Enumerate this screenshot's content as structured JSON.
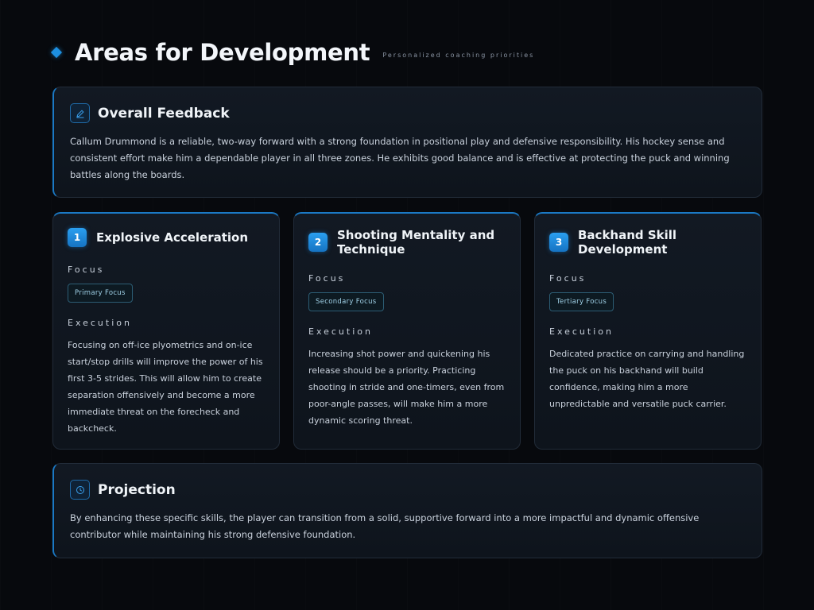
{
  "header": {
    "title": "Areas for Development",
    "subtitle": "Personalized coaching priorities"
  },
  "feedback": {
    "icon": "pencil-icon",
    "title": "Overall Feedback",
    "text": "Callum Drummond is a reliable, two-way forward with a strong foundation in positional play and defensive responsibility. His hockey sense and consistent effort make him a dependable player in all three zones. He exhibits good balance and is effective at protecting the puck and winning battles along the boards."
  },
  "areas": [
    {
      "number": "1",
      "title": "Explosive Acceleration",
      "focus_label": "Focus",
      "focus": "Primary Focus",
      "execution_label": "Execution",
      "execution": "Focusing on off-ice plyometrics and on-ice start/stop drills will improve the power of his first 3-5 strides. This will allow him to create separation offensively and become a more immediate threat on the forecheck and backcheck."
    },
    {
      "number": "2",
      "title": "Shooting Mentality and Technique",
      "focus_label": "Focus",
      "focus": "Secondary Focus",
      "execution_label": "Execution",
      "execution": "Increasing shot power and quickening his release should be a priority. Practicing shooting in stride and one-timers, even from poor-angle passes, will make him a more dynamic scoring threat."
    },
    {
      "number": "3",
      "title": "Backhand Skill Development",
      "focus_label": "Focus",
      "focus": "Tertiary Focus",
      "execution_label": "Execution",
      "execution": "Dedicated practice on carrying and handling the puck on his backhand will build confidence, making him a more unpredictable and versatile puck carrier."
    }
  ],
  "projection": {
    "icon": "clock-icon",
    "title": "Projection",
    "text": "By enhancing these specific skills, the player can transition from a solid, supportive forward into a more impactful and dynamic offensive contributor while maintaining his strong defensive foundation."
  },
  "colors": {
    "accent": "#1d8fe0",
    "background": "#07090d",
    "card": "#121923"
  }
}
